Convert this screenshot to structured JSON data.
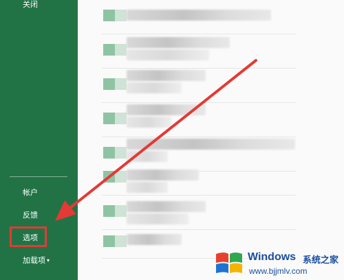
{
  "sidebar": {
    "close_label": "关闭",
    "account_label": "帐户",
    "feedback_label": "反馈",
    "options_label": "选项",
    "addins_label": "加载项",
    "addins_caret": "▾",
    "background_color": "#217346"
  },
  "recent_files": [
    {
      "name": "",
      "path": ""
    },
    {
      "name": "",
      "path": ""
    },
    {
      "name": "",
      "path": ""
    },
    {
      "name": "",
      "path": ""
    },
    {
      "name": "",
      "path": ""
    },
    {
      "name": "",
      "path": ""
    },
    {
      "name": "",
      "path": ""
    }
  ],
  "annotation": {
    "highlight_color": "#e53935",
    "arrow_color": "#e53935"
  },
  "watermark": {
    "title": "Windows",
    "title_cn": "系统之家",
    "url": "www.bjjmlv.com",
    "color": "#1b4fa0"
  }
}
